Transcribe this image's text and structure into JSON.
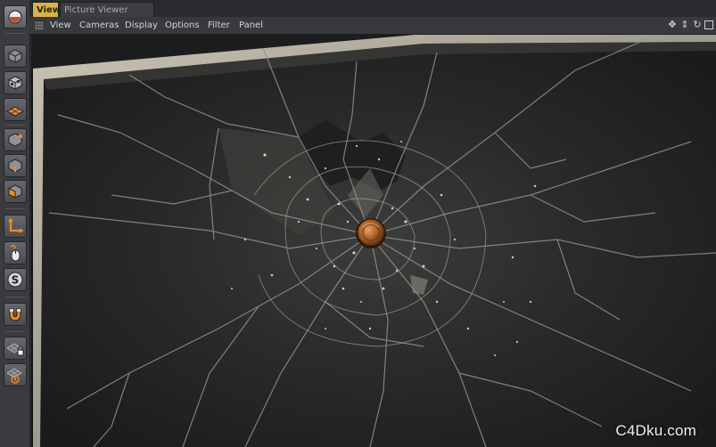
{
  "tabs": [
    {
      "label": "View",
      "active": true
    },
    {
      "label": "Picture Viewer",
      "active": false
    }
  ],
  "menubar": {
    "items": [
      "View",
      "Cameras",
      "Display",
      "Options",
      "Filter",
      "Panel"
    ]
  },
  "nav_icons": [
    "move-view-icon",
    "dolly-view-icon",
    "rotate-view-icon",
    "toggle-layout-icon"
  ],
  "toolbar": {
    "tools": [
      {
        "name": "undo-view-icon",
        "active": false
      },
      {
        "name": "model-mode-icon",
        "active": true
      },
      {
        "name": "texture-mode-icon",
        "active": true
      },
      {
        "name": "workplane-mode-icon",
        "active": true
      },
      {
        "name": "points-mode-icon",
        "active": true
      },
      {
        "name": "edges-mode-icon",
        "active": true
      },
      {
        "name": "polygons-mode-icon",
        "active": true
      },
      {
        "name": "enable-axis-icon",
        "active": true
      },
      {
        "name": "tweak-mode-icon",
        "active": true
      },
      {
        "name": "soft-selection-icon",
        "active": true
      },
      {
        "name": "snapping-icon",
        "active": true
      },
      {
        "name": "locked-workplane-icon",
        "active": true
      },
      {
        "name": "planar-workplane-icon",
        "active": true
      }
    ]
  },
  "viewport": {
    "content": "shattered-glass-render",
    "accent_coin": "#b7692e"
  },
  "watermark": "C4Dku.com",
  "colors": {
    "tab_active": "#d8b347",
    "tool_active": "#5a8bc4",
    "background": "#2f3033"
  }
}
